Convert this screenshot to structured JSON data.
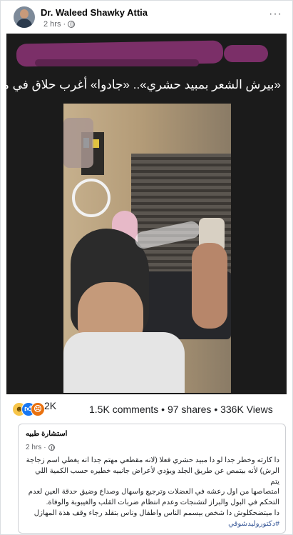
{
  "post": {
    "author": "Dr. Waleed Shawky Attia",
    "time": "2 hrs",
    "separator": "·",
    "menu_label": "···"
  },
  "media": {
    "headline": "«بيرش الشعر بمبيد حشري».. «جادوا» أغرب حلاق في مصر",
    "colors": {
      "scribble": "#7b2f68",
      "background": "#1b1b1b"
    }
  },
  "stats": {
    "reaction_icons": [
      "haha-icon",
      "like-icon",
      "angry-icon"
    ],
    "reactions": "2K",
    "engagement": "1.5K comments • 97 shares • 336K Views"
  },
  "shared_post": {
    "page_name": "استشارة طبيه",
    "time": "2 hrs",
    "separator": "·",
    "lines": [
      "دا كارثه وخطر جدا لو دا مبيد حشري فعلا (لانه مقطعي مهتم جدا انه يغطي اسم زجاجة",
      "الرش) لأنه بيتمص عن طريق الجلد ويؤدي لأعراض جانبيه خطيره حسب الكمية اللي يتم",
      "امتصاصها من اول رعشه في العضلات وترجيع واسهال وصداع وضيق حدقة العين لعدم",
      "التحكم في البول والبراز لتشنجات وعدم انتظام ضربات القلب والغيبوبة والوفاة.",
      "دا ميتضحكلوش دا شخص بيسمم الناس واطفال وناس بتقلد رجاء وقف هذة المهازل"
    ],
    "hashtag": "#دكتوروليدشوقي"
  },
  "colors": {
    "link": "#385898",
    "muted": "#65676b",
    "like": "#1877f2"
  }
}
